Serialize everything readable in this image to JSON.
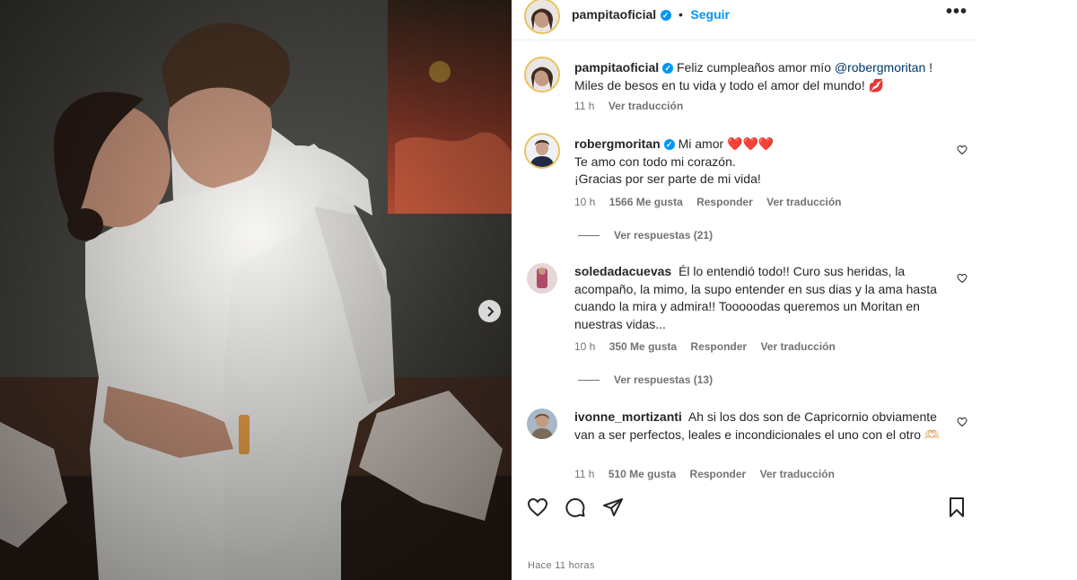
{
  "post": {
    "author": "pampitaoficial",
    "follow_label": "Seguir",
    "separator": "•",
    "more_label": "•••",
    "caption_user": "pampitaoficial",
    "caption_text_1": "Feliz cumpleaños amor mío",
    "caption_mention": "@robergmoritan",
    "caption_text_2": "! Miles de besos en tu vida y todo el amor del mundo!",
    "caption_emoji": "💋",
    "caption_time": "11 h",
    "caption_translate": "Ver traducción",
    "time_ago": "Hace 11 horas"
  },
  "comments": [
    {
      "user": "robergmoritan",
      "line1": "Mi amor",
      "hearts": "❤️❤️❤️",
      "line2": "Te amo con todo mi corazón.",
      "line3": "¡Gracias por ser parte de mi vida!",
      "time": "10 h",
      "likes": "1566 Me gusta",
      "reply": "Responder",
      "translate": "Ver traducción",
      "view_replies": "Ver respuestas (21)"
    },
    {
      "user": "soledadacuevas",
      "text": "Él lo entendió todo!! Curo sus heridas, la acompaño, la mimo, la supo entender en sus dias y la ama hasta cuando la mira y admira!! Tooooodas queremos un Moritan en nuestras vidas...",
      "time": "10 h",
      "likes": "350 Me gusta",
      "reply": "Responder",
      "translate": "Ver traducción",
      "view_replies": "Ver respuestas (13)"
    },
    {
      "user": "ivonne_mortizanti",
      "text": "Ah si los dos son de Capricornio obviamente van a ser perfectos, leales e incondicionales el uno con el otro 🫶🏻",
      "time": "11 h",
      "likes": "510 Me gusta",
      "reply": "Responder",
      "translate": "Ver traducción"
    }
  ],
  "colors": {
    "link": "#0095f6",
    "mention": "#00376b",
    "muted": "#737373",
    "text": "#262626"
  },
  "icons": {
    "like": "heart-icon",
    "comment": "comment-icon",
    "share": "send-icon",
    "save": "bookmark-icon",
    "next": "chevron-right-icon",
    "verified": "verified-badge-icon"
  }
}
